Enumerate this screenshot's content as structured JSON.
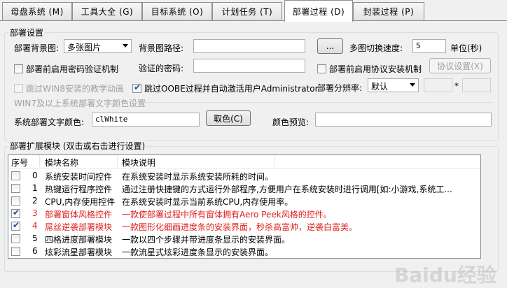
{
  "tabs": [
    {
      "label": "母盘系统 (M)",
      "active": false
    },
    {
      "label": "工具大全 (G)",
      "active": false
    },
    {
      "label": "目标系统 (O)",
      "active": false
    },
    {
      "label": "计划任务 (T)",
      "active": false
    },
    {
      "label": "部署过程 (D)",
      "active": true
    },
    {
      "label": "封装过程 (P)",
      "active": false
    }
  ],
  "settings": {
    "group_title": "部署设置",
    "bg_label": "部署背景图:",
    "bg_select": "多张图片",
    "bg_path_label": "背景图路径:",
    "bg_path_value": "",
    "browse_button": "...",
    "speed_label": "多图切换速度:",
    "speed_value": "5",
    "speed_unit": "单位(秒)",
    "pwd_check": "部署前启用密码验证机制",
    "pwd_label": "验证的密码:",
    "pwd_value": "",
    "protocol_check": "部署前启用协议安装机制",
    "protocol_button": "协议设置(X)",
    "skip_win8": "跳过WIN8安装的教学动画",
    "skip_oobe": "跳过OOBE过程并自动激活用户Administrator",
    "resolution_label": "部署分辨率:",
    "resolution_select": "默认",
    "res_width": "",
    "res_sep": "*",
    "res_height": "",
    "win7_section": "WIN7及以上系统部署文字颜色设置",
    "text_color_label": "系统部署文字颜色:",
    "text_color_value": "clWhite",
    "color_button": "取色(C)",
    "preview_label": "颜色预览:",
    "preview_value": ""
  },
  "modules": {
    "group_title": "部署扩展模块 (双击或右击进行设置)",
    "headers": [
      "序号",
      "模块名称",
      "模块说明"
    ],
    "rows": [
      {
        "index": "0",
        "name": "系统安装时间控件",
        "desc": "在系统安装时显示系统安装所耗的时间。",
        "checked": false,
        "red": false
      },
      {
        "index": "1",
        "name": "热键运行程序控件",
        "desc": "通过注册快捷键的方式运行外部程序,方便用户在系统安装时进行调用[如:小游戏,系统工...",
        "checked": false,
        "red": false
      },
      {
        "index": "2",
        "name": "CPU,内存使用控件",
        "desc": "在系统安装时显示当前系统CPU,内存使用率。",
        "checked": false,
        "red": false
      },
      {
        "index": "3",
        "name": "部署窗体风格控件",
        "desc": "一款使部署过程中所有窗体拥有Aero Peek风格的控件。",
        "checked": true,
        "red": true
      },
      {
        "index": "4",
        "name": "屌丝逆袭部署模块",
        "desc": "一款图形化细画进度条的安装界面，秒杀高富帅，逆袭白富美。",
        "checked": true,
        "red": true
      },
      {
        "index": "5",
        "name": "四格进度部署模块",
        "desc": "一款以四个步骤并带进度条显示的安装界面。",
        "checked": false,
        "red": false
      },
      {
        "index": "6",
        "name": "炫彩流星部署模块",
        "desc": "一款流星式炫彩进度条显示的安装界面。",
        "checked": false,
        "red": false
      }
    ]
  },
  "watermark": "Baidu经验"
}
